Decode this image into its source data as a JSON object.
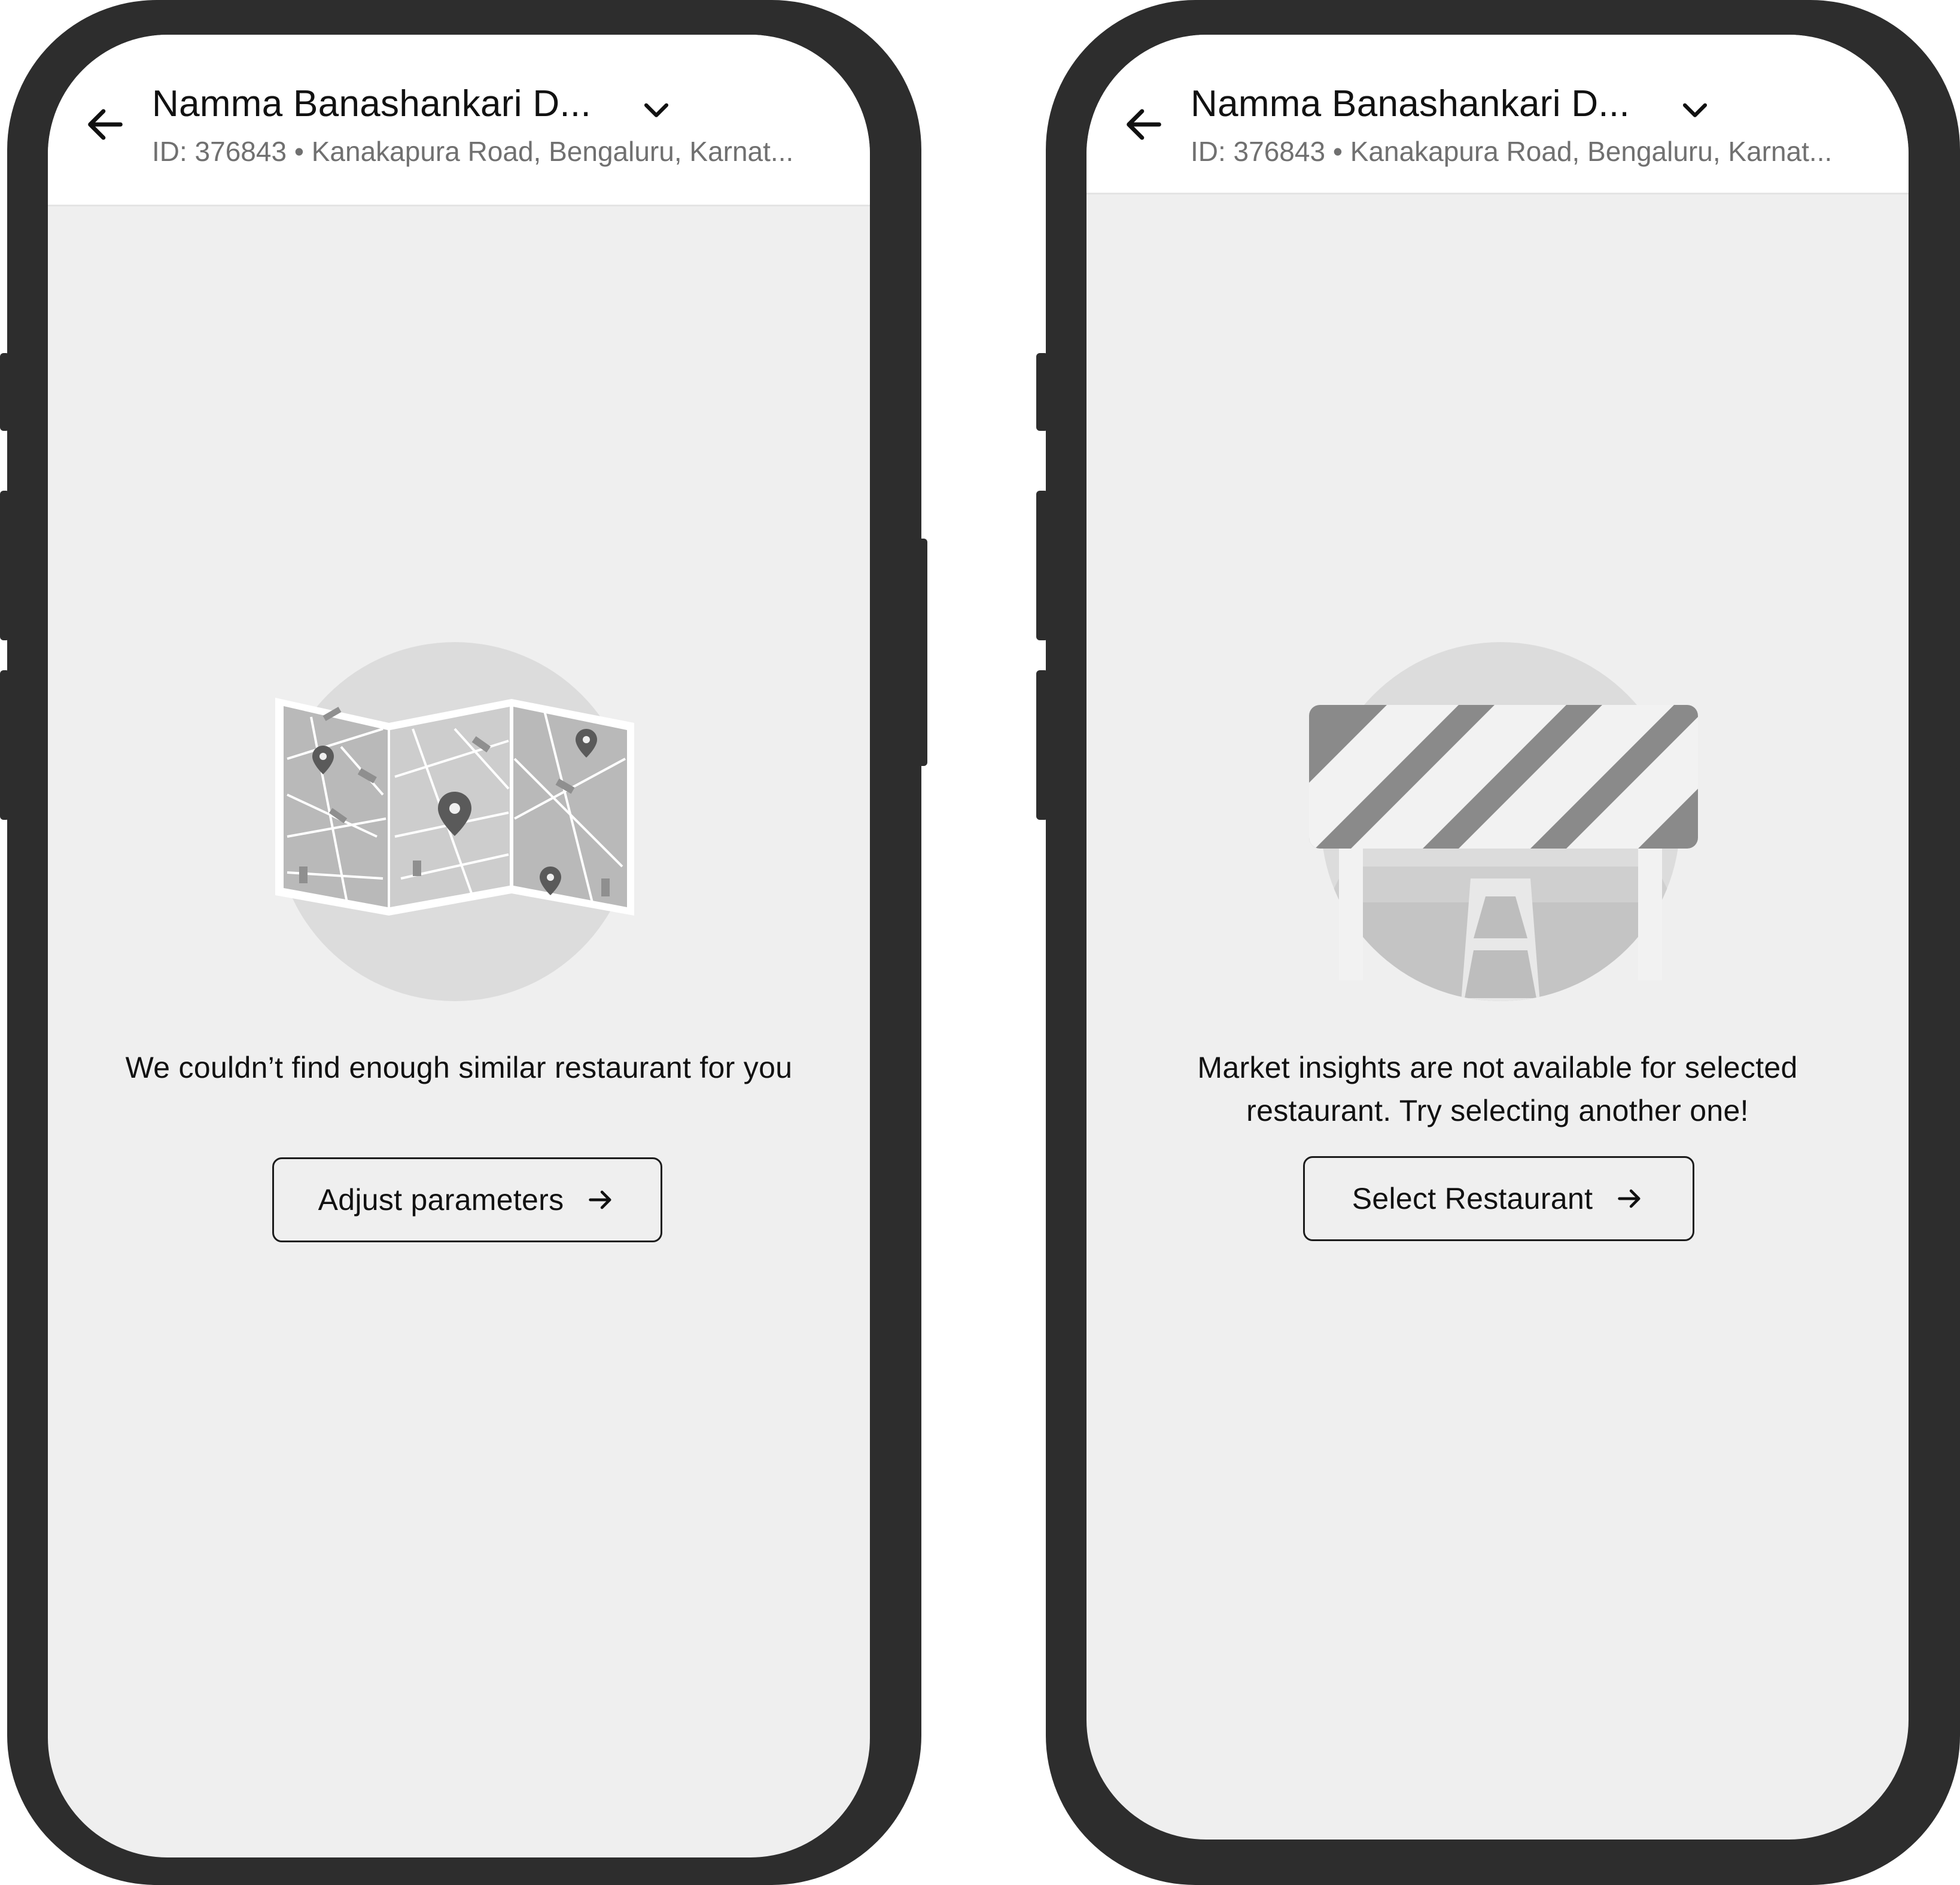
{
  "screens": [
    {
      "header": {
        "title": "Namma Banashankari D...",
        "subtitle": "ID: 376843 • Kanakapura Road, Bengaluru, Karnat..."
      },
      "illustration": "map-illustration",
      "message": "We couldn’t find enough similar restaurant for you",
      "cta": {
        "label": "Adjust parameters",
        "icon": "arrow-right-icon"
      }
    },
    {
      "header": {
        "title": "Namma Banashankari D...",
        "subtitle": "ID: 376843 • Kanakapura Road, Bengaluru, Karnat..."
      },
      "illustration": "road-barrier-illustration",
      "message": "Market insights are not available for selected restaurant. Try selecting another one!",
      "cta": {
        "label": "Select Restaurant",
        "icon": "arrow-right-icon"
      }
    }
  ],
  "colors": {
    "frame": "#2d2d2d",
    "screen_bg": "#efefef",
    "header_bg": "#ffffff",
    "text_primary": "#111111",
    "text_secondary": "#707070",
    "illustration_gray": "#8a8a8a"
  }
}
